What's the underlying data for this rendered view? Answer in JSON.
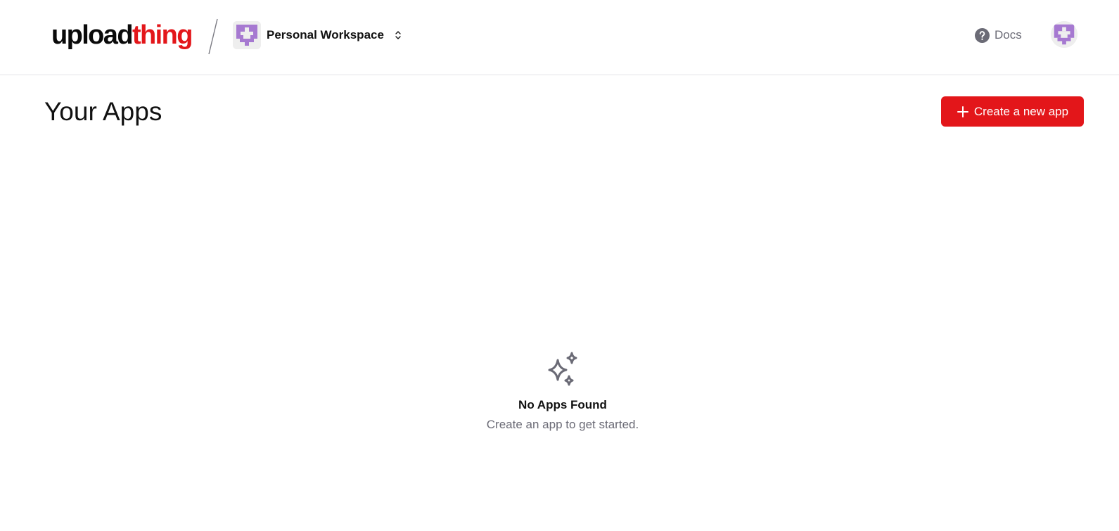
{
  "brand": {
    "part1": "upload",
    "part2": "thing",
    "accent_color": "#e3161a"
  },
  "workspace": {
    "name": "Personal Workspace",
    "icon": "identicon-avatar",
    "chevron_icon": "chevron-up-down-icon"
  },
  "header": {
    "docs_label": "Docs",
    "docs_icon": "help-circle-icon",
    "user_avatar_icon": "identicon-avatar"
  },
  "main": {
    "title": "Your Apps",
    "create_button_label": "Create a new app",
    "create_button_icon": "plus-icon"
  },
  "empty_state": {
    "icon": "sparkles-icon",
    "title": "No Apps Found",
    "subtitle": "Create an app to get started."
  },
  "colors": {
    "primary": "#e3161a",
    "avatar_purple": "#a679d1",
    "muted_text": "#6b6b76",
    "border": "#e4e4e7"
  }
}
